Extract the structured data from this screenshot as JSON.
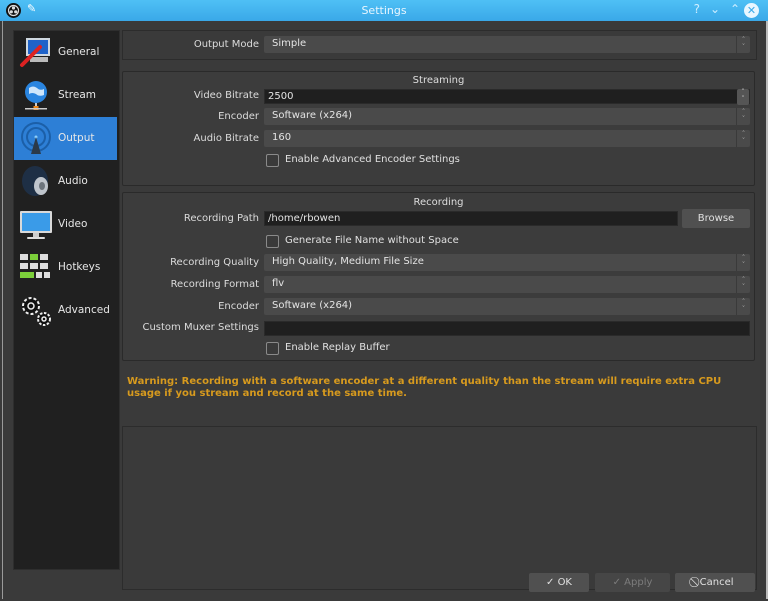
{
  "window": {
    "title": "Settings",
    "controls": {
      "help": "?",
      "minimize": "⌄",
      "maximize": "⌃",
      "close": "✕"
    }
  },
  "sidebar": {
    "items": [
      {
        "label": "General",
        "icon": "general-icon",
        "active": false
      },
      {
        "label": "Stream",
        "icon": "stream-icon",
        "active": false
      },
      {
        "label": "Output",
        "icon": "output-icon",
        "active": true
      },
      {
        "label": "Audio",
        "icon": "audio-icon",
        "active": false
      },
      {
        "label": "Video",
        "icon": "video-icon",
        "active": false
      },
      {
        "label": "Hotkeys",
        "icon": "hotkeys-icon",
        "active": false
      },
      {
        "label": "Advanced",
        "icon": "advanced-icon",
        "active": false
      }
    ]
  },
  "output": {
    "mode_label": "Output Mode",
    "mode_value": "Simple",
    "streaming": {
      "title": "Streaming",
      "video_bitrate_label": "Video Bitrate",
      "video_bitrate_value": "2500",
      "encoder_label": "Encoder",
      "encoder_value": "Software (x264)",
      "audio_bitrate_label": "Audio Bitrate",
      "audio_bitrate_value": "160",
      "advanced_encoder_label": "Enable Advanced Encoder Settings",
      "advanced_encoder_checked": false
    },
    "recording": {
      "title": "Recording",
      "path_label": "Recording Path",
      "path_value": "/home/rbowen",
      "browse_label": "Browse",
      "no_space_label": "Generate File Name without Space",
      "no_space_checked": false,
      "quality_label": "Recording Quality",
      "quality_value": "High Quality, Medium File Size",
      "format_label": "Recording Format",
      "format_value": "flv",
      "encoder_label": "Encoder",
      "encoder_value": "Software (x264)",
      "muxer_label": "Custom Muxer Settings",
      "muxer_value": "",
      "replay_buffer_label": "Enable Replay Buffer",
      "replay_buffer_checked": false
    },
    "warning": "Warning: Recording with a software encoder at a different quality than the stream will require extra CPU usage if you stream and record at the same time.",
    "warning_color": "#d79a1e"
  },
  "footer": {
    "ok_label": "OK",
    "apply_label": "Apply",
    "cancel_label": "Cancel"
  },
  "colors": {
    "accent": "#2d7fd6",
    "titlebar": "#3aa8e8"
  }
}
